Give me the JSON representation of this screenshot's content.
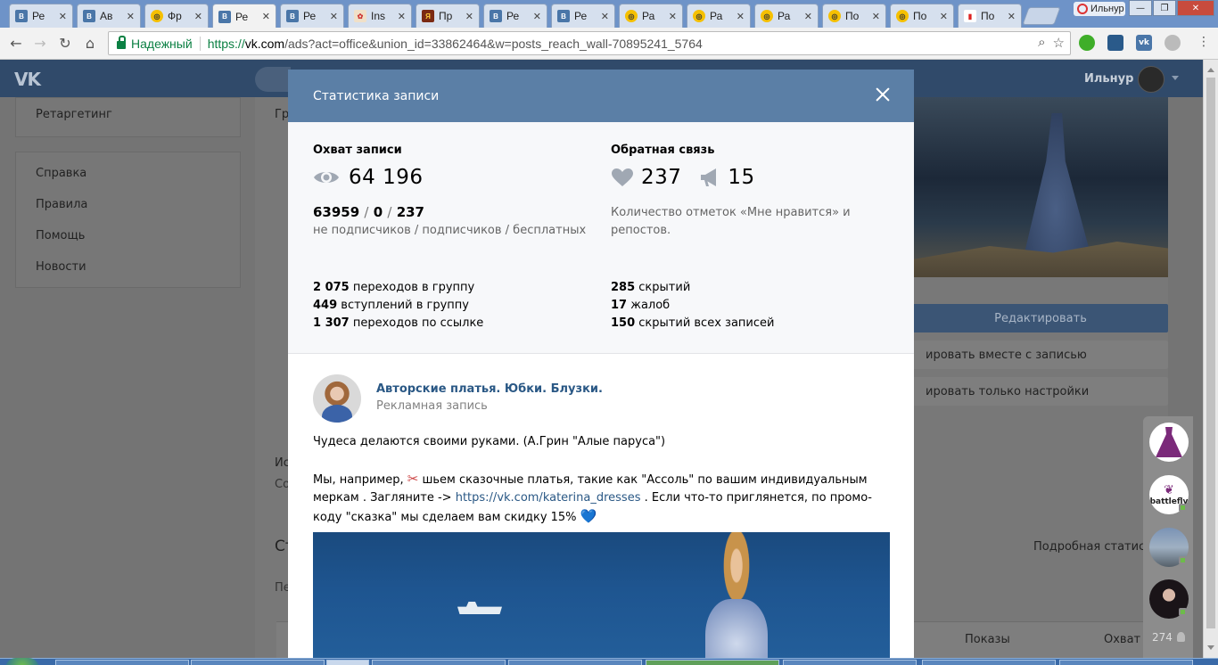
{
  "browser": {
    "tabs": [
      {
        "label": "Ре",
        "favicon": "vk"
      },
      {
        "label": "Ав",
        "favicon": "vk"
      },
      {
        "label": "Фр",
        "favicon": "yandex"
      },
      {
        "label": "Ре",
        "favicon": "vk",
        "active": true
      },
      {
        "label": "Ре",
        "favicon": "vk"
      },
      {
        "label": "Ins",
        "favicon": "insta"
      },
      {
        "label": "Пр",
        "favicon": "promo"
      },
      {
        "label": "Ре",
        "favicon": "vk"
      },
      {
        "label": "Ре",
        "favicon": "vk"
      },
      {
        "label": "Ра",
        "favicon": "yandex"
      },
      {
        "label": "Ра",
        "favicon": "yandex"
      },
      {
        "label": "Ра",
        "favicon": "yandex"
      },
      {
        "label": "По",
        "favicon": "yandex"
      },
      {
        "label": "По",
        "favicon": "yandex"
      },
      {
        "label": "По",
        "favicon": "stats"
      }
    ],
    "close_glyph": "✕",
    "user_label": "Ильнур",
    "secure_label": "Надежный",
    "url_scheme": "https://",
    "url_host": "vk.com",
    "url_rest": "/ads?act=office&union_id=33862464&w=posts_reach_wall-70895241_5764",
    "window_controls": [
      "—",
      "❐",
      "✕"
    ],
    "extensions": [
      {
        "name": "green-refresh-extension",
        "color": "#3fae29"
      },
      {
        "name": "stack-extension",
        "color": "#2a5a8a"
      },
      {
        "name": "vk-extension",
        "color": "#4a76a8",
        "text": "vk"
      },
      {
        "name": "circle-extension",
        "color": "#bbbbbb"
      }
    ]
  },
  "vk": {
    "user_name": "Ильнур",
    "menu_top": [
      "Ретаргетинг"
    ],
    "menu_bottom": [
      "Справка",
      "Правила",
      "Помощь",
      "Новости"
    ],
    "bg_labels": {
      "gr": "Гр",
      "is": "Ис",
      "so": "Со",
      "st": "Ст",
      "pe": "Пе",
      "edit": "Редактировать",
      "copy_with_post": "ировать вместе с записью",
      "copy_settings": "ировать только настройки",
      "detailed_stats": "Подробная статист",
      "col_views": "Показы",
      "col_reach": "Охват"
    },
    "rail_avatars": [
      "dress",
      "battlefly",
      "street",
      "girl"
    ],
    "rail_battlefly_label": "battlefly",
    "rail_count": "274"
  },
  "modal": {
    "title": "Статистика записи",
    "reach_heading": "Охват записи",
    "reach_total": "64 196",
    "reach_split_nonsub": "63959",
    "reach_split_sub": "0",
    "reach_split_free": "237",
    "reach_split_sep": "/",
    "reach_split_caption": "не подписчиков / подписчиков / бесплатных",
    "feedback_heading": "Обратная связь",
    "likes": "237",
    "reposts": "15",
    "feedback_caption_1": "Количество отметок «Мне нравится» и",
    "feedback_caption_2": "репостов.",
    "left_stats": [
      {
        "value": "2 075",
        "label": "переходов в группу"
      },
      {
        "value": "449",
        "label": "вступлений в группу"
      },
      {
        "value": "1 307",
        "label": "переходов по ссылке"
      }
    ],
    "right_stats": [
      {
        "value": "285",
        "label": "скрытий"
      },
      {
        "value": "17",
        "label": "жалоб"
      },
      {
        "value": "150",
        "label": "скрытий всех записей"
      }
    ]
  },
  "post": {
    "author": "Авторские платья. Юбки. Блузки.",
    "subtitle": "Рекламная запись",
    "line1": "Чудеса делаются своими руками. (А.Грин \"Алые паруса\")",
    "para_a": "Мы, например, ",
    "scissors": "✂",
    "para_b": " шьем сказочные платья, такие как \"Ассоль\" по вашим индивидуальным меркам . Загляните -> ",
    "link": "https://vk.com/katerina_dresses",
    "para_c": " . Если что-то приглянется, по промо-коду \"сказка\" мы сделаем вам скидку 15% ",
    "heart_emoji": "💙"
  },
  "colors": {
    "vk_blue": "#5b7fa6",
    "link": "#2a5885"
  }
}
